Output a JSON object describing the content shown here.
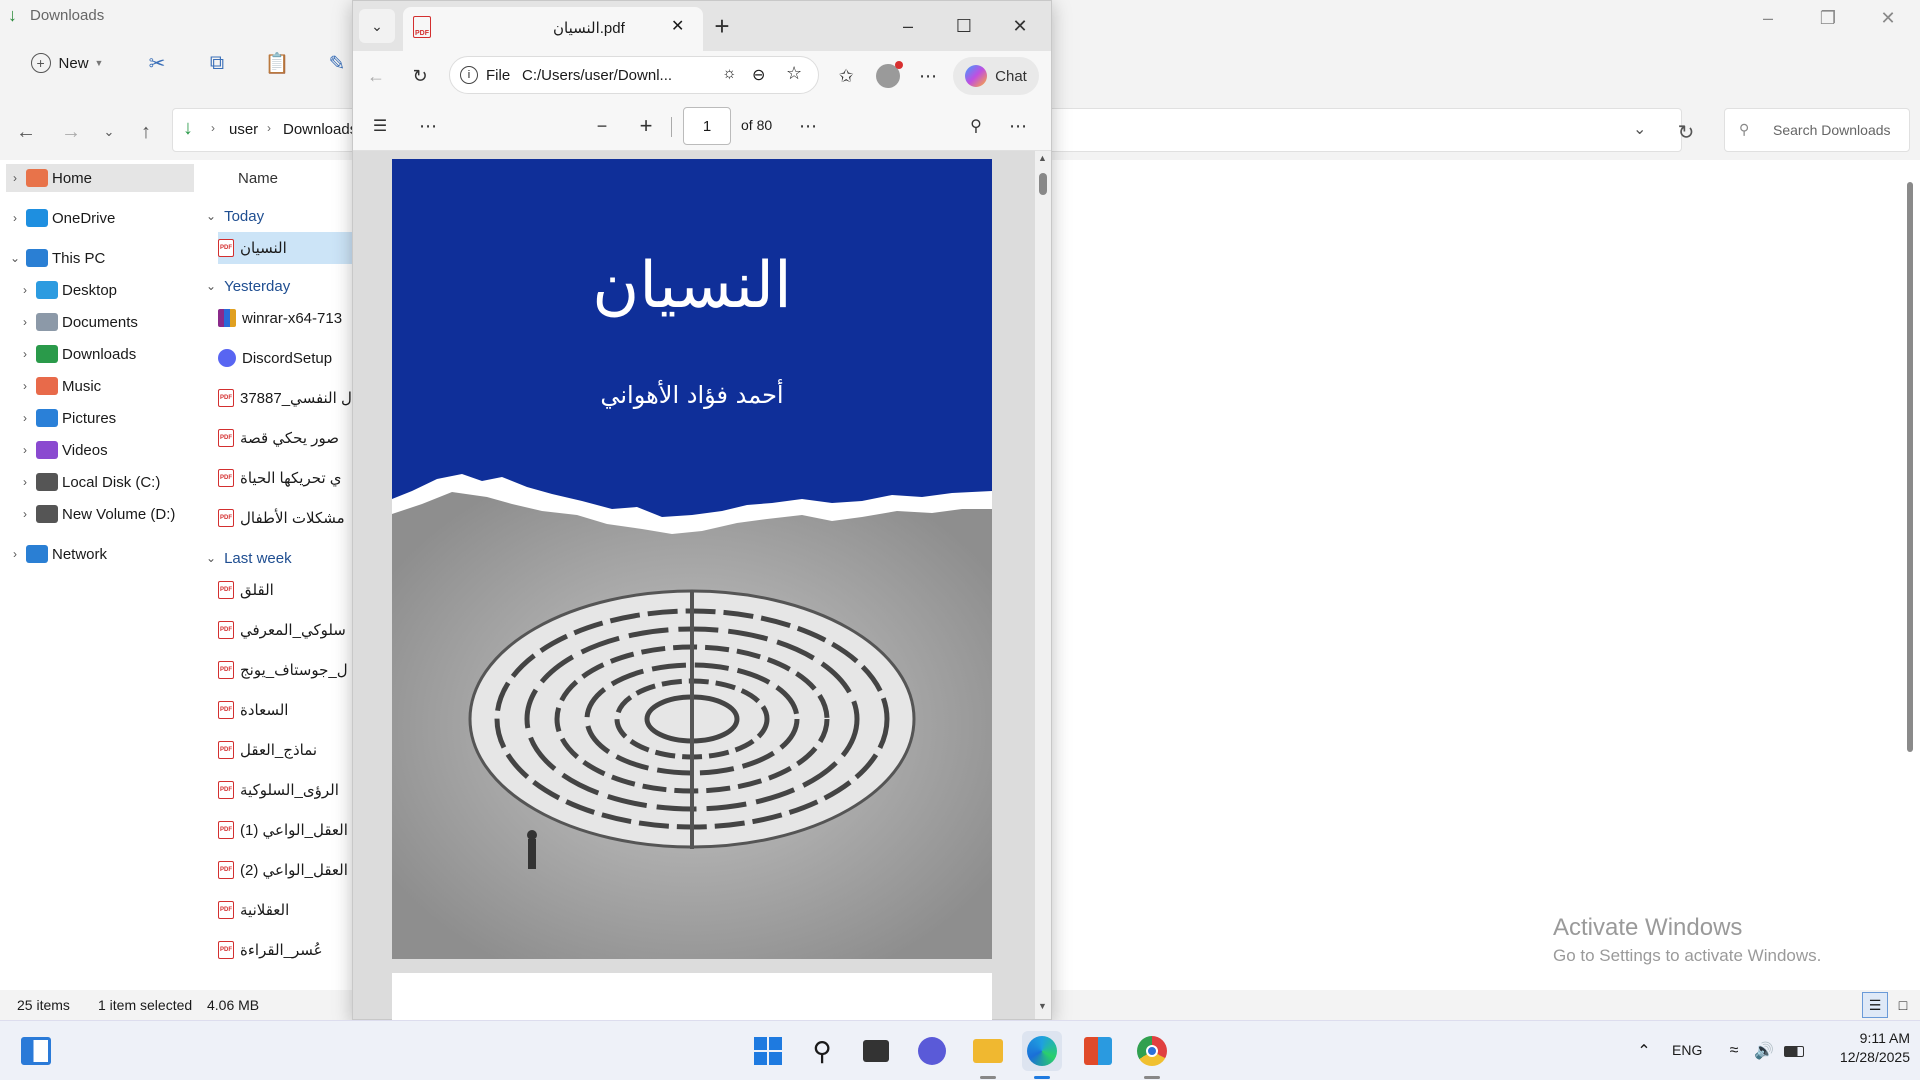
{
  "explorer": {
    "title": "Downloads",
    "new_label": "New",
    "breadcrumb": [
      "user",
      "Downloads"
    ],
    "search_placeholder": "Search Downloads",
    "column_name": "Name",
    "sidebar": [
      {
        "label": "Home",
        "icon": "home-icon",
        "color": "#e8734a"
      },
      {
        "label": "OneDrive",
        "icon": "cloud-icon",
        "color": "#1e8fe0"
      },
      {
        "label": "This PC",
        "icon": "monitor-icon",
        "color": "#2a7fd4"
      },
      {
        "label": "Desktop",
        "icon": "desktop-icon",
        "color": "#2c9be0"
      },
      {
        "label": "Documents",
        "icon": "documents-icon",
        "color": "#8c99a8"
      },
      {
        "label": "Downloads",
        "icon": "download-icon",
        "color": "#2a9a4a"
      },
      {
        "label": "Music",
        "icon": "music-icon",
        "color": "#e86a4a"
      },
      {
        "label": "Pictures",
        "icon": "pictures-icon",
        "color": "#2a80d8"
      },
      {
        "label": "Videos",
        "icon": "videos-icon",
        "color": "#8a4ad0"
      },
      {
        "label": "Local Disk (C:)",
        "icon": "drive-icon",
        "color": "#555555"
      },
      {
        "label": "New Volume (D:)",
        "icon": "drive-icon",
        "color": "#555555"
      },
      {
        "label": "Network",
        "icon": "network-icon",
        "color": "#2a7fd4"
      }
    ],
    "groups": {
      "today": "Today",
      "yesterday": "Yesterday",
      "last_week": "Last week"
    },
    "files_today": [
      "النسيان"
    ],
    "files_yesterday": [
      "winrar-x64-713",
      "DiscordSetup",
      "ل النفسي_37887",
      "صور يحكي قصة",
      "ي تحريكها الحياة",
      "مشكلات الأطفال"
    ],
    "files_last_week": [
      "القلق",
      "سلوكي_المعرفي",
      "ل_جوستاف_يونج",
      "السعادة",
      "نماذج_العقل",
      "الرؤى_السلوكية",
      "العقل_الواعي (1)",
      "العقل_الواعي (2)",
      "العقلانية",
      "عُسر_القراءة"
    ],
    "status_count": "25 items",
    "status_selected": "1 item selected",
    "status_size": "4.06 MB"
  },
  "edge": {
    "tab_title": "النسيان.pdf",
    "url_scheme": "File",
    "url": "C:/Users/user/Downl...",
    "chat_label": "Chat",
    "page_current": "1",
    "page_total": "of 80"
  },
  "pdf": {
    "book_title": "النسيان",
    "book_author": "أحمد فؤاد الأهواني"
  },
  "watermark": {
    "line1": "Activate Windows",
    "line2": "Go to Settings to activate Windows."
  },
  "tray": {
    "language": "ENG",
    "time": "9:11 AM",
    "date": "12/28/2025"
  }
}
